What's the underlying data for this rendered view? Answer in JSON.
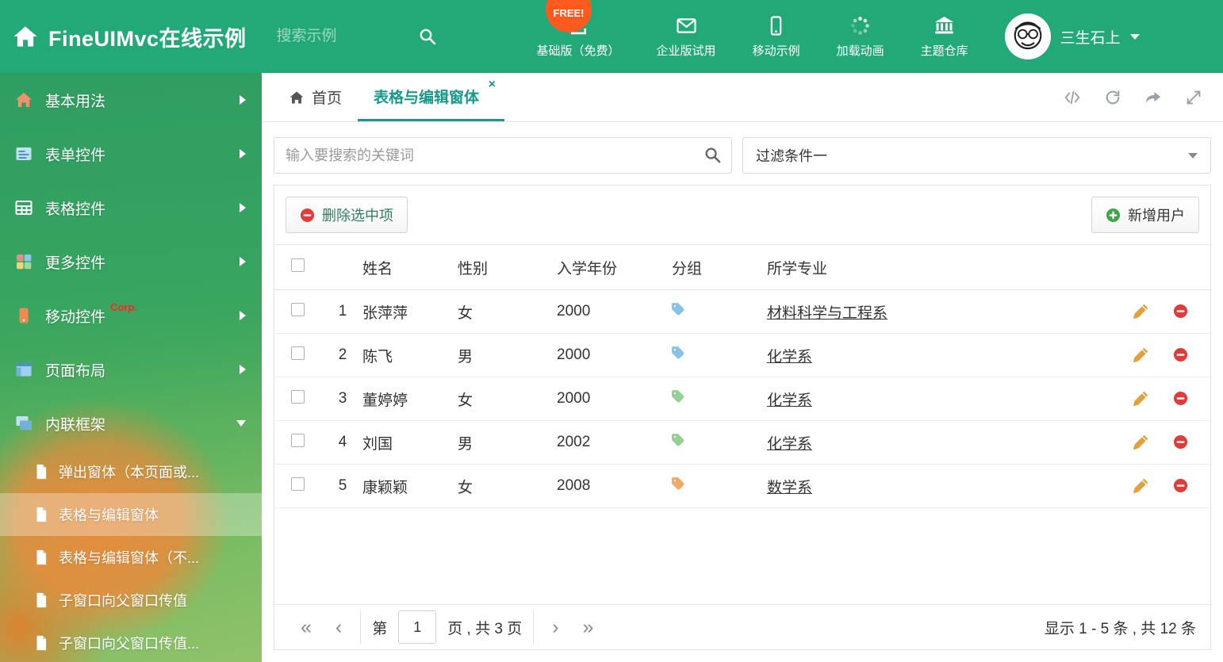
{
  "colors": {
    "header_bg": "#23a878",
    "active_tab": "#18998a",
    "free_badge_bg": "#ff5a1e",
    "delete_red": "#e23b3b",
    "add_green": "#3fa54a",
    "edit_pencil": "#e0a23c"
  },
  "header": {
    "title": "FineUIMvc在线示例",
    "search_placeholder": "搜索示例",
    "free_badge": "FREE!",
    "nav_items": [
      {
        "label": "基础版（免费）",
        "icon": "download-icon"
      },
      {
        "label": "企业版试用",
        "icon": "envelope-icon"
      },
      {
        "label": "移动示例",
        "icon": "mobile-icon"
      },
      {
        "label": "加载动画",
        "icon": "spinner-icon"
      },
      {
        "label": "主题仓库",
        "icon": "bank-icon"
      }
    ],
    "user_name": "三生石上"
  },
  "sidebar": {
    "items": [
      {
        "label": "基本用法",
        "icon": "home-icon"
      },
      {
        "label": "表单控件",
        "icon": "form-icon"
      },
      {
        "label": "表格控件",
        "icon": "table-icon"
      },
      {
        "label": "更多控件",
        "icon": "widgets-icon"
      },
      {
        "label": "移动控件",
        "badge": "Corp.",
        "icon": "mobile-icon"
      },
      {
        "label": "页面布局",
        "icon": "layout-icon"
      },
      {
        "label": "内联框架",
        "icon": "frames-icon",
        "expanded": true
      }
    ],
    "children": [
      {
        "label": "弹出窗体（本页面或..."
      },
      {
        "label": "表格与编辑窗体",
        "active": true
      },
      {
        "label": "表格与编辑窗体（不..."
      },
      {
        "label": "子窗口向父窗口传值"
      },
      {
        "label": "子窗口向父窗口传值..."
      }
    ]
  },
  "tabs": [
    {
      "label": "首页"
    },
    {
      "label": "表格与编辑窗体",
      "active": true,
      "closable": true
    }
  ],
  "filters": {
    "search_placeholder": "输入要搜索的关键词",
    "filter_value": "过滤条件一"
  },
  "grid": {
    "delete_button": "删除选中项",
    "add_button": "新增用户",
    "columns": [
      "姓名",
      "性别",
      "入学年份",
      "分组",
      "所学专业"
    ],
    "rows": [
      {
        "num": "1",
        "name": "张萍萍",
        "gender": "女",
        "year": "2000",
        "tag_color": "#85c4e8",
        "major": "材料科学与工程系"
      },
      {
        "num": "2",
        "name": "陈飞",
        "gender": "男",
        "year": "2000",
        "tag_color": "#85c4e8",
        "major": "化学系"
      },
      {
        "num": "3",
        "name": "董婷婷",
        "gender": "女",
        "year": "2000",
        "tag_color": "#96d096",
        "major": "化学系"
      },
      {
        "num": "4",
        "name": "刘国",
        "gender": "男",
        "year": "2002",
        "tag_color": "#96d096",
        "major": "化学系"
      },
      {
        "num": "5",
        "name": "康颖颖",
        "gender": "女",
        "year": "2008",
        "tag_color": "#f0a868",
        "major": "数学系"
      }
    ],
    "pagination": {
      "page_prefix": "第",
      "current_page": "1",
      "page_suffix": "页 , 共 3 页",
      "summary": "显示 1 - 5 条 , 共 12 条"
    }
  }
}
